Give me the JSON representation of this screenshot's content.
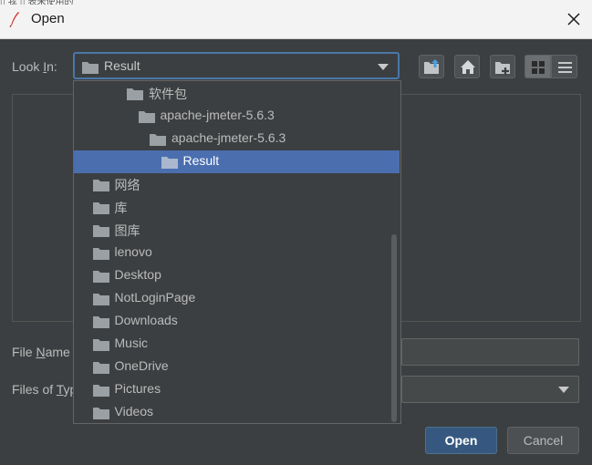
{
  "window": {
    "title": "Open",
    "behind_text": "▯ 我 ▯ 表未使用的",
    "colors": {
      "accent": "#4b6eaf",
      "background": "#3c3f41",
      "primary_button": "#365880"
    }
  },
  "look_in": {
    "label_prefix": "Look ",
    "label_mnemonic": "I",
    "label_suffix": "n:",
    "value": "Result"
  },
  "toolbar": {
    "buttons": [
      {
        "name": "up-one-level",
        "icon": "folder-up-icon"
      },
      {
        "name": "home",
        "icon": "home-icon"
      },
      {
        "name": "create-new-folder",
        "icon": "new-folder-icon"
      },
      {
        "name": "list-view",
        "icon": "grid-view-icon",
        "selected": true
      },
      {
        "name": "details-view",
        "icon": "list-view-icon",
        "selected": false
      }
    ]
  },
  "dropdown": {
    "items": [
      {
        "label": "软件包",
        "indent": 4,
        "selected": false
      },
      {
        "label": "apache-jmeter-5.6.3",
        "indent": 5,
        "selected": false
      },
      {
        "label": "apache-jmeter-5.6.3",
        "indent": 6,
        "selected": false
      },
      {
        "label": "Result",
        "indent": 7,
        "selected": true
      },
      {
        "label": "网络",
        "indent": 1,
        "selected": false
      },
      {
        "label": "库",
        "indent": 1,
        "selected": false
      },
      {
        "label": "图库",
        "indent": 1,
        "selected": false
      },
      {
        "label": "lenovo",
        "indent": 1,
        "selected": false
      },
      {
        "label": "Desktop",
        "indent": 1,
        "selected": false
      },
      {
        "label": "NotLoginPage",
        "indent": 1,
        "selected": false
      },
      {
        "label": "Downloads",
        "indent": 1,
        "selected": false
      },
      {
        "label": "Music",
        "indent": 1,
        "selected": false
      },
      {
        "label": "OneDrive",
        "indent": 1,
        "selected": false
      },
      {
        "label": "Pictures",
        "indent": 1,
        "selected": false
      },
      {
        "label": "Videos",
        "indent": 1,
        "selected": false
      }
    ]
  },
  "file_name": {
    "label_prefix": "File ",
    "label_mnemonic": "N",
    "label_suffix": "ame",
    "value": ""
  },
  "files_of_type": {
    "label_prefix": "Files of ",
    "label_mnemonic": "T",
    "label_suffix": "yp",
    "value": ""
  },
  "buttons": {
    "open": "Open",
    "cancel": "Cancel"
  }
}
